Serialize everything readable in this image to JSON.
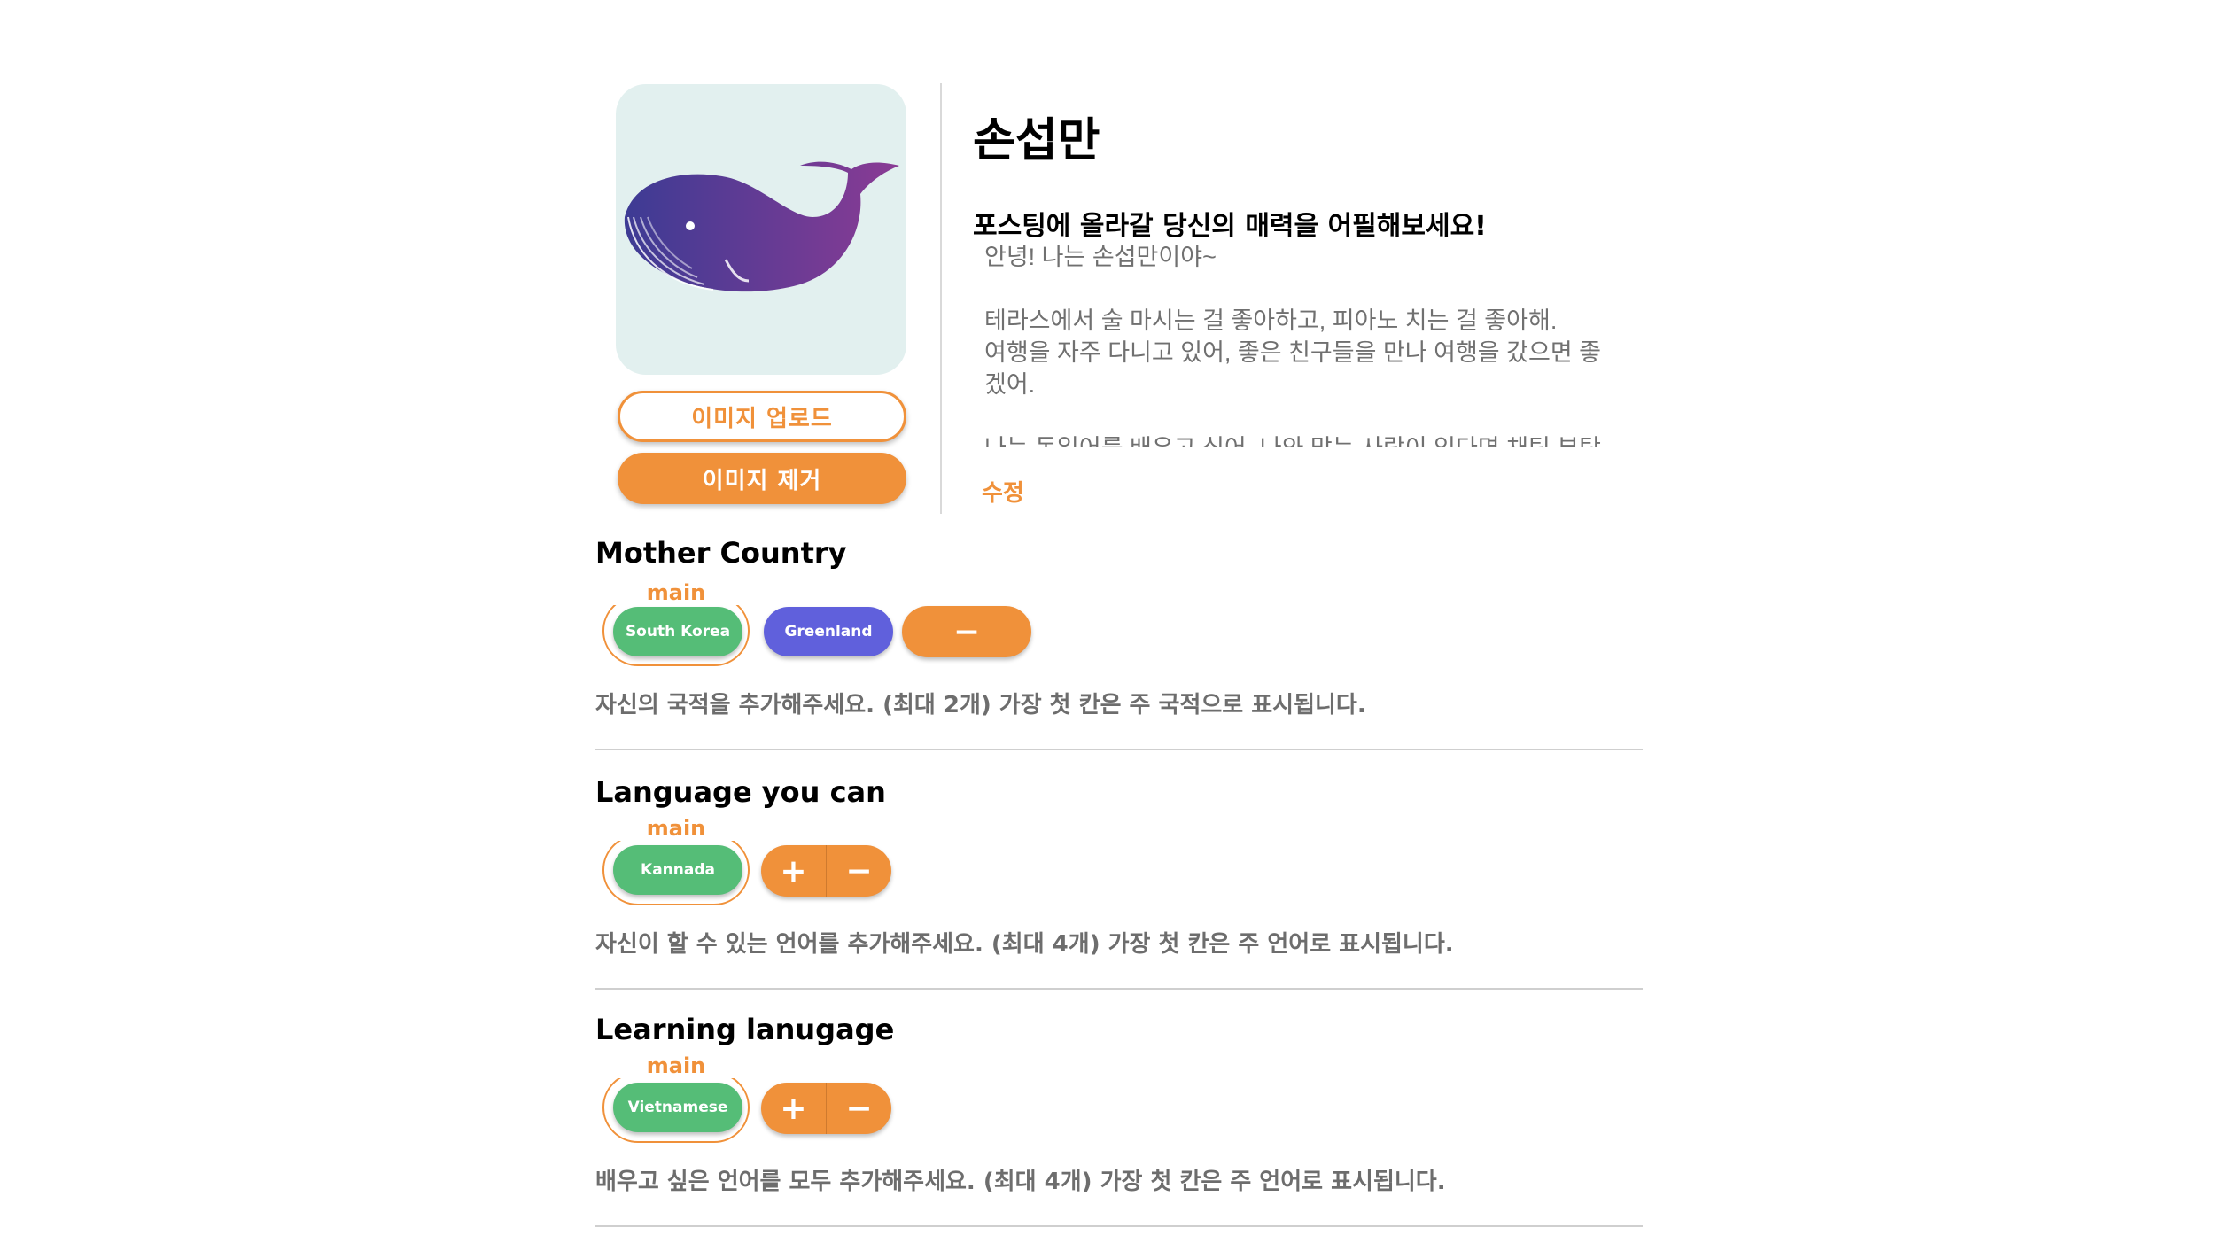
{
  "profile": {
    "name": "손섭만",
    "bio_heading": "포스팅에 올라갈 당신의 매력을 어필해보세요!",
    "bio_text": "안녕! 나는 손섭만이야~\n\n테라스에서 술 마시는 걸 좋아하고, 피아노 치는 걸 좋아해.\n여행을 자주 다니고 있어, 좋은 친구들을 만나 여행을 갔으면 좋겠어.\n\n나는 독일어를 배우고 싶어, 나와 맞는 사람이 있다면 채팅 부탁",
    "upload_label": "이미지 업로드",
    "remove_label": "이미지 제거",
    "edit_label": "수정",
    "avatar_icon": "whale-icon"
  },
  "colors": {
    "accent": "#f0913a",
    "green": "#55bd77",
    "blue": "#6060dc"
  },
  "mother_country": {
    "title": "Mother Country",
    "main_label": "main",
    "chips": [
      "South Korea",
      "Greenland"
    ],
    "remove_label": "−",
    "hint": "자신의 국적을 추가해주세요. (최대 2개) 가장 첫 칸은 주 국적으로 표시됩니다."
  },
  "language": {
    "title": "Language you can",
    "main_label": "main",
    "chips": [
      "Kannada"
    ],
    "add_label": "+",
    "remove_label": "−",
    "hint": "자신이 할 수 있는 언어를 추가해주세요. (최대 4개) 가장 첫 칸은 주 언어로 표시됩니다."
  },
  "learning": {
    "title": "Learning lanugage",
    "main_label": "main",
    "chips": [
      "Vietnamese"
    ],
    "add_label": "+",
    "remove_label": "−",
    "hint": "배우고 싶은 언어를 모두 추가해주세요. (최대 4개) 가장 첫 칸은 주 언어로 표시됩니다."
  }
}
